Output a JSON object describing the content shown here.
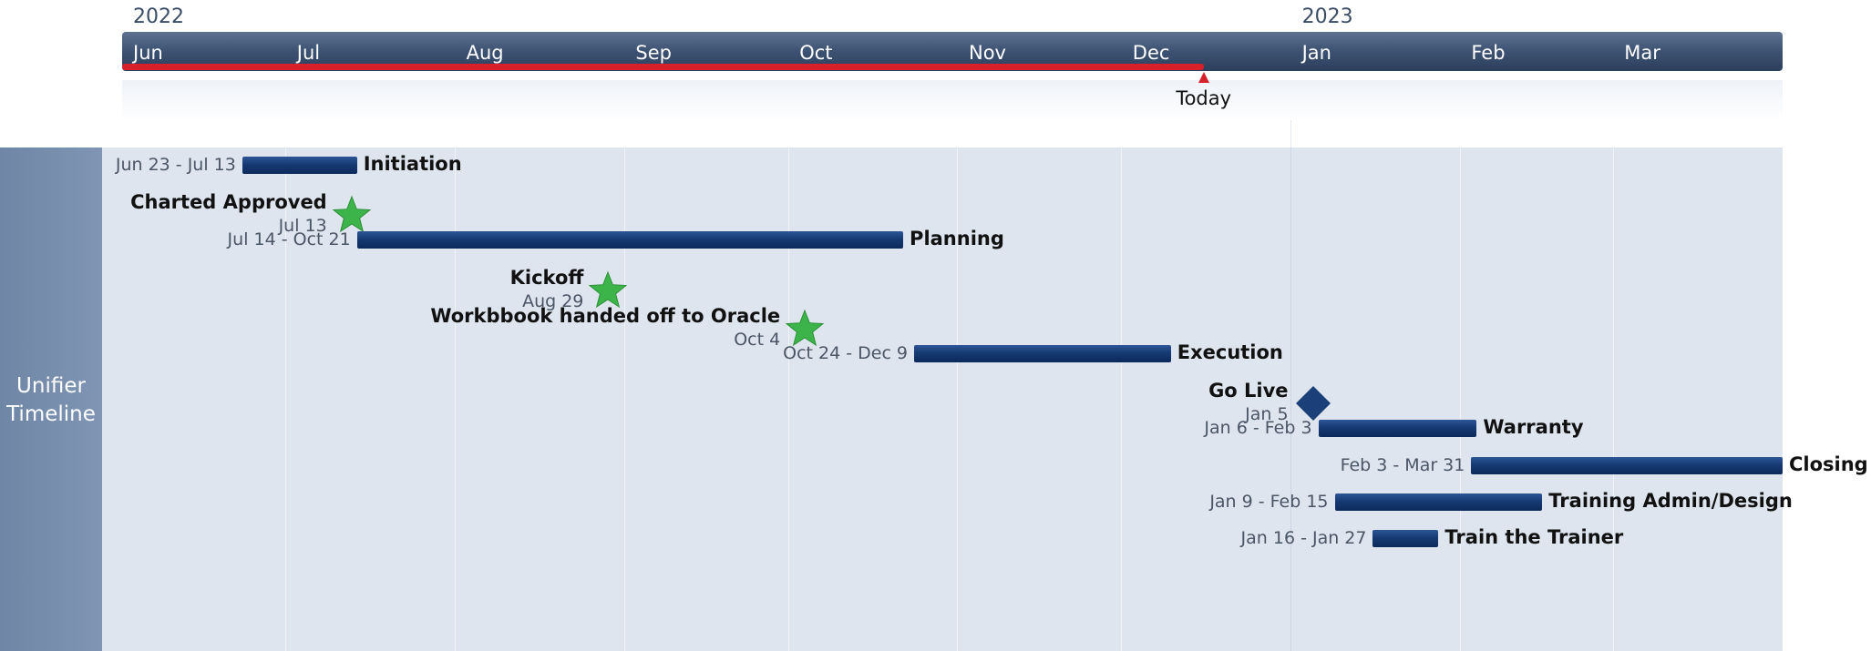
{
  "chart_data": {
    "type": "gantt",
    "title": "",
    "years": [
      {
        "label": "2022",
        "start": "2022-06-01"
      },
      {
        "label": "2023",
        "start": "2023-01-01"
      }
    ],
    "axis": {
      "start": "2022-06-01",
      "end": "2023-03-31",
      "months": [
        {
          "label": "Jun",
          "start": "2022-06-01"
        },
        {
          "label": "Jul",
          "start": "2022-07-01"
        },
        {
          "label": "Aug",
          "start": "2022-08-01"
        },
        {
          "label": "Sep",
          "start": "2022-09-01"
        },
        {
          "label": "Oct",
          "start": "2022-10-01"
        },
        {
          "label": "Nov",
          "start": "2022-11-01"
        },
        {
          "label": "Dec",
          "start": "2022-12-01"
        },
        {
          "label": "Jan",
          "start": "2023-01-01"
        },
        {
          "label": "Feb",
          "start": "2023-02-01"
        },
        {
          "label": "Mar",
          "start": "2023-03-01"
        }
      ]
    },
    "today": {
      "label": "Today",
      "date": "2022-12-16"
    },
    "swimlane": {
      "label": "Unifier Timeline"
    },
    "items": [
      {
        "kind": "task",
        "name": "Initiation",
        "dates": "Jun 23 - Jul 13",
        "start": "2022-06-23",
        "end": "2022-07-13"
      },
      {
        "kind": "milestone",
        "shape": "star",
        "name": "Charted Approved",
        "dates": "Jul 13",
        "date": "2022-07-13"
      },
      {
        "kind": "task",
        "name": "Planning",
        "dates": "Jul 14 - Oct 21",
        "start": "2022-07-14",
        "end": "2022-10-21"
      },
      {
        "kind": "milestone",
        "shape": "star",
        "name": "Kickoff",
        "dates": "Aug 29",
        "date": "2022-08-29"
      },
      {
        "kind": "milestone",
        "shape": "star",
        "name": "Workbbook handed off to Oracle",
        "dates": "Oct 4",
        "date": "2022-10-04"
      },
      {
        "kind": "task",
        "name": "Execution",
        "dates": "Oct 24 - Dec 9",
        "start": "2022-10-24",
        "end": "2022-12-09"
      },
      {
        "kind": "milestone",
        "shape": "diamond",
        "name": "Go Live",
        "dates": "Jan 5",
        "date": "2023-01-05"
      },
      {
        "kind": "task",
        "name": "Warranty",
        "dates": "Jan 6 - Feb 3",
        "start": "2023-01-06",
        "end": "2023-02-03"
      },
      {
        "kind": "task",
        "name": "Closing",
        "dates": "Feb 3 - Mar 31",
        "start": "2023-02-03",
        "end": "2023-03-31"
      },
      {
        "kind": "task",
        "name": "Training Admin/Design",
        "dates": "Jan 9 - Feb 15",
        "start": "2023-01-09",
        "end": "2023-02-15"
      },
      {
        "kind": "task",
        "name": "Train the Trainer",
        "dates": "Jan 16 - Jan 27",
        "start": "2023-01-16",
        "end": "2023-01-27"
      }
    ],
    "colors": {
      "task_bar": "#163a73",
      "star": "#3cb44a",
      "diamond": "#1b3f78",
      "today": "#d8202b",
      "scale_bar": "#3d5272",
      "swimlane": "#dfe5ee"
    }
  }
}
